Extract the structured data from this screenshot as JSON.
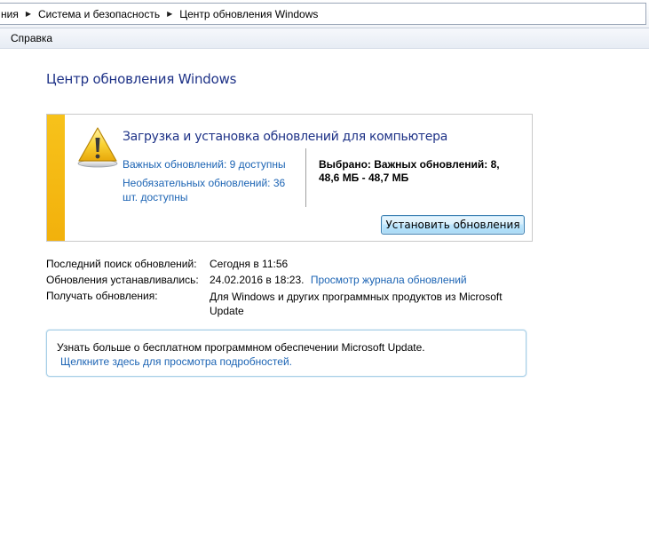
{
  "breadcrumb": {
    "items": [
      "ния",
      "Система и безопасность",
      "Центр обновления Windows"
    ]
  },
  "menu": {
    "items": [
      "Справка"
    ]
  },
  "page_title": "Центр обновления Windows",
  "update_panel": {
    "heading": "Загрузка и установка обновлений для компьютера",
    "important_link": "Важных обновлений: 9 доступны",
    "optional_link": "Необязательных обновлений: 36 шт. доступны",
    "selected_text": "Выбрано: Важных обновлений: 8, 48,6 МБ - 48,7 МБ",
    "install_button": "Установить обновления",
    "icon": "warning-icon",
    "accent_color": "#f4b90f"
  },
  "info": {
    "last_search_label": "Последний поиск обновлений:",
    "last_search_value": "Сегодня в 11:56",
    "installed_label": "Обновления устанавливались:",
    "installed_value": "24.02.2016 в 18:23.",
    "history_link": "Просмотр журнала обновлений",
    "receive_label": "Получать обновления:",
    "receive_value": "Для Windows и других программных продуктов из Microsoft Update"
  },
  "microsoft_update_box": {
    "text": "Узнать больше о бесплатном программном обеспечении Microsoft Update.",
    "link": "Щелкните здесь для просмотра подробностей."
  }
}
